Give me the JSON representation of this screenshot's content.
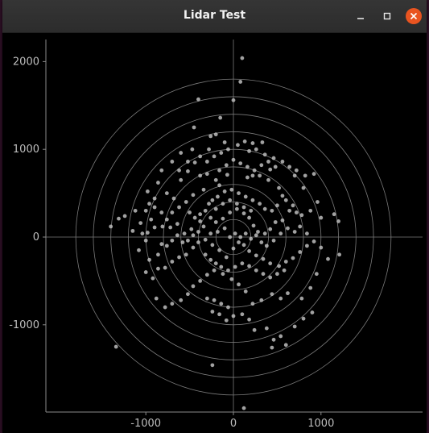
{
  "window": {
    "title": "Lidar Test",
    "buttons": {
      "minimize": "minimize-icon",
      "maximize": "maximize-icon",
      "close": "close-icon"
    },
    "close_color": "#e95420"
  },
  "chart_data": {
    "type": "scatter",
    "title": "",
    "xlabel": "",
    "ylabel": "",
    "xlim": [
      -2000,
      2000
    ],
    "ylim": [
      -2000,
      2250
    ],
    "xticks": [
      -1000,
      0,
      1000
    ],
    "yticks": [
      -1000,
      0,
      1000,
      2000
    ],
    "xtick_labels": [
      "-1000",
      "0",
      "1000"
    ],
    "ytick_labels": [
      "-1000",
      "0",
      "1000",
      "2000"
    ],
    "polar_rings": [
      200,
      400,
      600,
      800,
      1000,
      1200,
      1400,
      1600,
      1800
    ],
    "grid": "polar rings with crosshair axes",
    "point_color": "#bdbdbd",
    "series": [
      {
        "points": [
          [
            100,
            2040
          ],
          [
            80,
            1770
          ],
          [
            0,
            1560
          ],
          [
            -400,
            1570
          ],
          [
            -150,
            1360
          ],
          [
            -450,
            1250
          ],
          [
            -200,
            1170
          ],
          [
            -260,
            1150
          ],
          [
            -470,
            1000
          ],
          [
            50,
            1050
          ],
          [
            130,
            1090
          ],
          [
            220,
            1070
          ],
          [
            260,
            1000
          ],
          [
            330,
            1080
          ],
          [
            -100,
            1080
          ],
          [
            -440,
            850
          ],
          [
            -520,
            750
          ],
          [
            -620,
            760
          ],
          [
            -600,
            650
          ],
          [
            -380,
            700
          ],
          [
            -300,
            720
          ],
          [
            -200,
            650
          ],
          [
            -160,
            590
          ],
          [
            -70,
            710
          ],
          [
            160,
            680
          ],
          [
            220,
            700
          ],
          [
            300,
            700
          ],
          [
            400,
            650
          ],
          [
            420,
            770
          ],
          [
            520,
            560
          ],
          [
            560,
            470
          ],
          [
            700,
            700
          ],
          [
            800,
            560
          ],
          [
            920,
            720
          ],
          [
            1000,
            220
          ],
          [
            1150,
            260
          ],
          [
            1200,
            180
          ],
          [
            960,
            400
          ],
          [
            880,
            300
          ],
          [
            780,
            250
          ],
          [
            640,
            300
          ],
          [
            560,
            190
          ],
          [
            480,
            170
          ],
          [
            420,
            90
          ],
          [
            360,
            40
          ],
          [
            280,
            60
          ],
          [
            230,
            130
          ],
          [
            180,
            220
          ],
          [
            120,
            270
          ],
          [
            40,
            320
          ],
          [
            -40,
            280
          ],
          [
            -120,
            210
          ],
          [
            -200,
            170
          ],
          [
            -260,
            220
          ],
          [
            -340,
            120
          ],
          [
            -400,
            60
          ],
          [
            -480,
            90
          ],
          [
            -560,
            40
          ],
          [
            -640,
            150
          ],
          [
            -720,
            110
          ],
          [
            -810,
            120
          ],
          [
            -900,
            110
          ],
          [
            -980,
            50
          ],
          [
            -1040,
            40
          ],
          [
            -1120,
            300
          ],
          [
            -1240,
            240
          ],
          [
            -1310,
            210
          ],
          [
            -1400,
            120
          ],
          [
            -1150,
            70
          ],
          [
            -1080,
            -150
          ],
          [
            -1000,
            -400
          ],
          [
            -920,
            -470
          ],
          [
            -860,
            -360
          ],
          [
            -780,
            -350
          ],
          [
            -700,
            -280
          ],
          [
            -620,
            -230
          ],
          [
            -540,
            -200
          ],
          [
            -460,
            -120
          ],
          [
            -400,
            -60
          ],
          [
            -320,
            -30
          ],
          [
            -240,
            -90
          ],
          [
            -160,
            -150
          ],
          [
            -80,
            -230
          ],
          [
            0,
            -130
          ],
          [
            60,
            -60
          ],
          [
            120,
            -90
          ],
          [
            180,
            -160
          ],
          [
            260,
            -210
          ],
          [
            340,
            -250
          ],
          [
            420,
            -300
          ],
          [
            520,
            -330
          ],
          [
            600,
            -280
          ],
          [
            680,
            -240
          ],
          [
            760,
            -170
          ],
          [
            840,
            -100
          ],
          [
            920,
            -50
          ],
          [
            1000,
            -120
          ],
          [
            1080,
            -250
          ],
          [
            1210,
            -200
          ],
          [
            950,
            -420
          ],
          [
            880,
            -580
          ],
          [
            780,
            -700
          ],
          [
            620,
            -640
          ],
          [
            540,
            -700
          ],
          [
            440,
            -650
          ],
          [
            320,
            -720
          ],
          [
            220,
            -760
          ],
          [
            140,
            -620
          ],
          [
            60,
            -540
          ],
          [
            -20,
            -480
          ],
          [
            -120,
            -420
          ],
          [
            -220,
            -380
          ],
          [
            -300,
            -430
          ],
          [
            -380,
            -500
          ],
          [
            -460,
            -560
          ],
          [
            -520,
            -650
          ],
          [
            -600,
            -720
          ],
          [
            -700,
            -760
          ],
          [
            -780,
            -800
          ],
          [
            -880,
            -700
          ],
          [
            -300,
            -700
          ],
          [
            -220,
            -720
          ],
          [
            -140,
            -760
          ],
          [
            -60,
            -800
          ],
          [
            -240,
            -850
          ],
          [
            -160,
            -880
          ],
          [
            -80,
            -950
          ],
          [
            0,
            -900
          ],
          [
            100,
            -880
          ],
          [
            180,
            -940
          ],
          [
            240,
            -1060
          ],
          [
            380,
            -1040
          ],
          [
            460,
            -1170
          ],
          [
            540,
            -1130
          ],
          [
            600,
            -1230
          ],
          [
            700,
            -1020
          ],
          [
            800,
            -930
          ],
          [
            900,
            -860
          ],
          [
            440,
            -1260
          ],
          [
            -1340,
            -1250
          ],
          [
            -240,
            -1460
          ],
          [
            120,
            -1950
          ],
          [
            -240,
            420
          ],
          [
            -180,
            460
          ],
          [
            -100,
            520
          ],
          [
            -20,
            540
          ],
          [
            60,
            500
          ],
          [
            140,
            460
          ],
          [
            220,
            420
          ],
          [
            300,
            380
          ],
          [
            360,
            320
          ],
          [
            440,
            300
          ],
          [
            500,
            360
          ],
          [
            600,
            420
          ],
          [
            680,
            360
          ],
          [
            720,
            280
          ],
          [
            -460,
            480
          ],
          [
            -540,
            400
          ],
          [
            -620,
            340
          ],
          [
            -700,
            280
          ],
          [
            -760,
            200
          ],
          [
            -820,
            280
          ],
          [
            -900,
            340
          ],
          [
            -980,
            520
          ],
          [
            -860,
            620
          ],
          [
            -760,
            500
          ],
          [
            -680,
            440
          ],
          [
            -340,
            540
          ],
          [
            -280,
            380
          ],
          [
            -200,
            320
          ],
          [
            -120,
            380
          ],
          [
            -40,
            420
          ],
          [
            40,
            380
          ],
          [
            120,
            340
          ],
          [
            200,
            300
          ],
          [
            -320,
            -200
          ],
          [
            -260,
            -260
          ],
          [
            -200,
            -300
          ],
          [
            -140,
            -340
          ],
          [
            -60,
            -380
          ],
          [
            20,
            -340
          ],
          [
            100,
            -300
          ],
          [
            180,
            -330
          ],
          [
            260,
            -380
          ],
          [
            340,
            -420
          ],
          [
            420,
            -460
          ],
          [
            500,
            -420
          ],
          [
            580,
            -380
          ],
          [
            -760,
            -100
          ],
          [
            -700,
            -40
          ],
          [
            -640,
            20
          ],
          [
            -580,
            -60
          ],
          [
            -520,
            -40
          ],
          [
            -460,
            20
          ],
          [
            -380,
            260
          ],
          [
            -320,
            300
          ],
          [
            -260,
            40
          ],
          [
            -180,
            60
          ],
          [
            -100,
            100
          ],
          [
            -40,
            0
          ],
          [
            20,
            40
          ],
          [
            80,
            0
          ],
          [
            140,
            40
          ],
          [
            200,
            -20
          ],
          [
            260,
            20
          ],
          [
            320,
            -60
          ],
          [
            380,
            -100
          ],
          [
            460,
            -40
          ],
          [
            540,
            40
          ],
          [
            620,
            100
          ],
          [
            700,
            60
          ],
          [
            760,
            120
          ],
          [
            840,
            40
          ],
          [
            -860,
            -200
          ],
          [
            -820,
            -80
          ],
          [
            -960,
            -260
          ],
          [
            -1000,
            -40
          ],
          [
            -1060,
            160
          ],
          [
            -940,
            200
          ],
          [
            -500,
            280
          ],
          [
            -440,
            220
          ],
          [
            -380,
            180
          ],
          [
            -160,
            760
          ],
          [
            -80,
            820
          ],
          [
            0,
            880
          ],
          [
            80,
            840
          ],
          [
            160,
            800
          ],
          [
            240,
            760
          ],
          [
            320,
            820
          ],
          [
            400,
            860
          ],
          [
            480,
            800
          ],
          [
            -300,
            860
          ],
          [
            -220,
            920
          ],
          [
            -140,
            960
          ],
          [
            -380,
            920
          ],
          [
            -520,
            860
          ],
          [
            -600,
            960
          ],
          [
            -700,
            860
          ],
          [
            -280,
            1000
          ],
          [
            -60,
            1000
          ],
          [
            180,
            980
          ],
          [
            360,
            940
          ],
          [
            460,
            900
          ],
          [
            560,
            860
          ],
          [
            640,
            800
          ],
          [
            720,
            760
          ],
          [
            820,
            700
          ],
          [
            -820,
            760
          ],
          [
            -900,
            440
          ],
          [
            -960,
            380
          ],
          [
            -1000,
            300
          ]
        ]
      }
    ]
  }
}
